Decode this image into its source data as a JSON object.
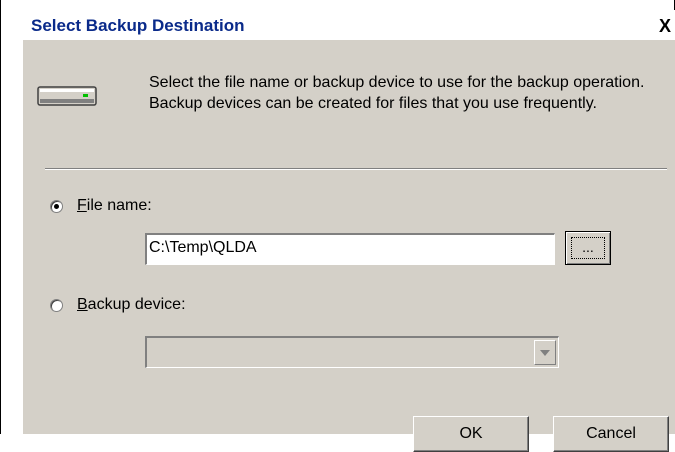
{
  "dialog": {
    "title": "Select Backup Destination",
    "close_label": "X",
    "intro_text": "Select the file name or backup device to use for the backup operation.  Backup devices can be created for files that you use frequently.",
    "file_name": {
      "accel": "F",
      "label_rest": "ile name:",
      "selected": true,
      "value": "C:\\Temp\\QLDA",
      "browse_label": "..."
    },
    "backup_device": {
      "accel": "B",
      "label_rest": "ackup device:",
      "selected": false,
      "value": ""
    },
    "ok_label": "OK",
    "cancel_label": "Cancel"
  },
  "icons": {
    "drive": "drive-icon",
    "close": "close-icon",
    "dropdown": "chevron-down-icon"
  }
}
